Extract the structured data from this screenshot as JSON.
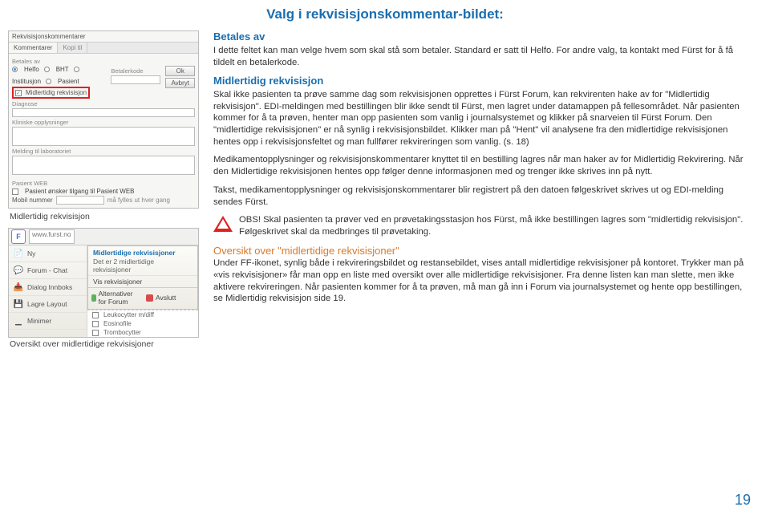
{
  "page_title": "Valg i rekvisisjonskommentar-bildet:",
  "page_number": "19",
  "screenshot_top": {
    "panel_title": "Rekvisisjonskommentarer",
    "tabs": [
      "Kommentarer",
      "Kopi til"
    ],
    "betales_label": "Betales av",
    "betales_options": [
      "Helfo",
      "BHT",
      "Institusjon",
      "Pasient"
    ],
    "betalerkode_label": "Betalerkode",
    "buttons": [
      "Ok",
      "Avbryt"
    ],
    "midlertidig_label": "Midlertidig rekvisisjon",
    "diagnose_label": "Diagnose",
    "kliniske_label": "Kliniske opplysninger",
    "melding_label": "Melding til laboratoriet",
    "pasient_web_label": "Pasient WEB",
    "pasient_check_label": "Pasient ønsker tilgang til Pasient WEB",
    "mobil_label": "Mobil nummer",
    "mobil_note": "må fylles ut hver gang"
  },
  "caption1": "Midlertidig rekvisisjon",
  "screenshot_menu": {
    "url": "www.furst.no",
    "left_items": [
      {
        "icon": "📄",
        "label": "Ny"
      },
      {
        "icon": "💬",
        "label": "Forum - Chat"
      },
      {
        "icon": "📥",
        "label": "Dialog Innboks"
      },
      {
        "icon": "💾",
        "label": "Lagre Layout"
      },
      {
        "icon": "▁",
        "label": "Minimer"
      }
    ],
    "submenu_title": "Midlertidige rekvisisjoner",
    "submenu_line": "Det er 2 midlertidige rekvisisjoner",
    "submenu_item": "Vis rekvisisjoner",
    "submenu_foot1": "Alternativer for Forum",
    "submenu_foot2": "Avslutt",
    "right_items": [
      "Leukocytter m/diff",
      "Eosinofile",
      "Trombocytter"
    ]
  },
  "caption2": "Oversikt over midlertidige rekvisisjoner",
  "section_betales": {
    "heading": "Betales av",
    "text": "I dette feltet kan man velge hvem som skal stå som betaler. Standard er satt til Helfo. For andre valg, ta kontakt med Fürst for å få tildelt en betalerkode."
  },
  "section_midlertidig": {
    "heading": "Midlertidig rekvisisjon",
    "text": "Skal ikke pasienten ta prøve samme dag som rekvisisjonen opprettes i Fürst Forum, kan rekvirenten hake av for \"Midlertidig rekvisisjon\". EDI-meldingen med bestillingen blir ikke sendt til Fürst, men lagret under datamappen på fellesområdet. Når pasienten kommer for å ta prøven, henter man opp pasienten som vanlig i journalsystemet og klikker på snarveien til Fürst Forum. Den \"midlertidige rekvisisjonen\" er nå synlig i rekvisisjonsbildet. Klikker man på \"Hent\" vil analysene fra den midlertidige rekvisisjonen hentes opp i rekvisisjonsfeltet og man fullfører rekvireringen som vanlig. (s. 18)"
  },
  "para_medikament": "Medikamentopplysninger og rekvisisjonskommentarer knyttet til en bestilling lagres når man haker av for Midlertidig Rekvirering. Når den Midlertidige rekvisisjonen hentes opp følger denne informasjonen med og trenger ikke skrives inn på nytt.",
  "para_takst": "Takst, medikamentopplysninger og rekvisisjonskommentarer blir registrert på den datoen følgeskrivet skrives ut og EDI-melding sendes Fürst.",
  "para_obs": "OBS! Skal pasienten ta prøver ved en prøvetakingsstasjon hos Fürst, må ikke bestillingen lagres som \"midlertidig rekvisisjon\". Følgeskrivet skal da medbringes til prøvetaking.",
  "section_oversikt": {
    "heading": "Oversikt over \"midlertidige rekvisisjoner\"",
    "text": "Under FF-ikonet, synlig både i rekvireringsbildet og restansebildet, vises antall midlertidige rekvisisjoner på kontoret. Trykker man på «vis rekvisisjoner» får man opp en liste med oversikt over alle midlertidige rekvisisjoner. Fra denne listen kan man slette, men ikke aktivere rekvireringen. Når pasienten kommer for å ta prøven, må man gå inn i Forum via journalsystemet og hente opp bestillingen, se Midlertidig rekvisisjon side 19."
  }
}
